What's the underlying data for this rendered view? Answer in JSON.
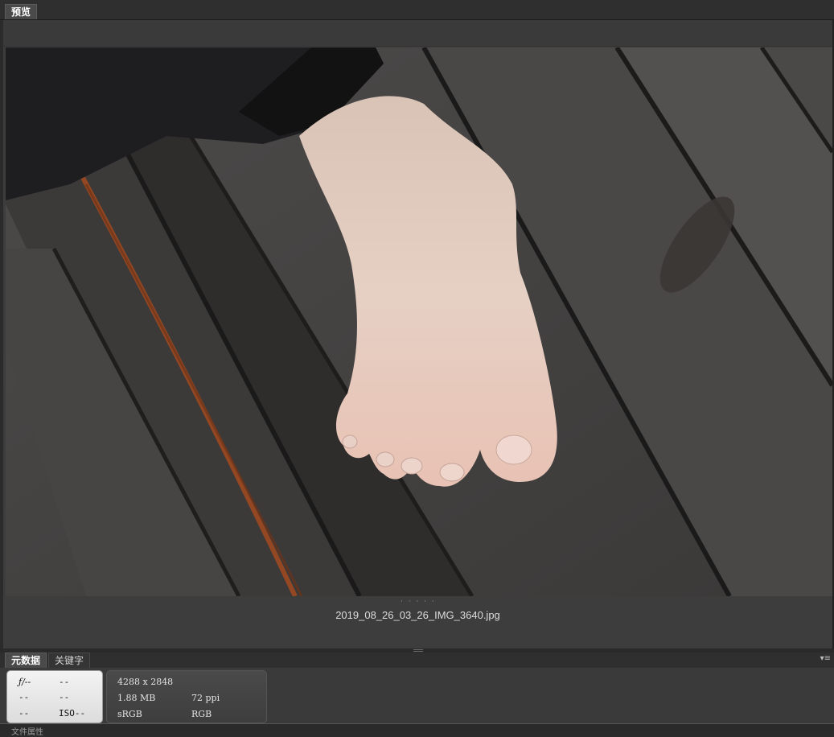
{
  "top_tabs": {
    "preview": "预览"
  },
  "preview": {
    "filename": "2019_08_26_03_26_IMG_3640.jpg",
    "dots": "· · · · ·"
  },
  "meta_tabs": {
    "metadata": "元数据",
    "keywords": "关键字"
  },
  "panel_menu_icon": "panel-menu-icon",
  "exif": {
    "aperture": "ƒ/--",
    "shutter": "--",
    "exposure_comp": "--",
    "metering": "--",
    "white_balance": "--",
    "iso": "ISO--"
  },
  "file_info": {
    "dimensions": "4288 x 2848",
    "size": "1.88 MB",
    "resolution": "72 ppi",
    "color_profile": "sRGB",
    "color_mode": "RGB"
  },
  "cut_label": "文件属性",
  "colors": {
    "panel_bg": "#3d3d3d",
    "tab_active": "#4a4a4a",
    "exif_bg": "#e8e8e8"
  }
}
